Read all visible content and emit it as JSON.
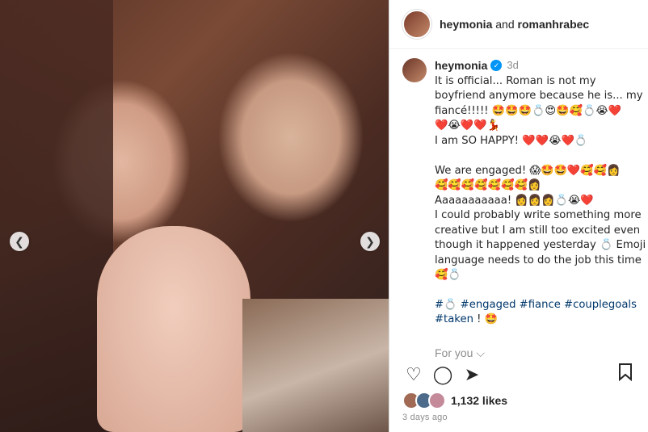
{
  "post": {
    "header": {
      "user1": "heymonia",
      "joiner": "and",
      "user2": "romanhrabec"
    },
    "caption": {
      "username": "heymonia",
      "verified_icon": "verified-badge-icon",
      "age": "3d",
      "lines": [
        "It is official... Roman is not my",
        "boyfriend anymore because he is... my",
        "fiancé!!!!! 🤩🤩🤩💍😍🤩🥰💍😭❤️",
        "❤️😭❤️❤️💃",
        "I am SO HAPPY! ❤️❤️😭❤️💍",
        "",
        "We are engaged! 😱🤩🤩❤️🥰🥰👩",
        "🥰🥰🥰🥰🥰🥰🥰👩",
        "Aaaaaaaaaaa! 👩👩👩💍😭❤️",
        "I could probably write something more",
        "creative but I am still too excited even",
        "though it happened yesterday 💍 Emoji",
        "language needs to do the job this time",
        "🥰💍"
      ],
      "hashtags_line1": "#💍 #engaged #fiance #couplegoals",
      "hashtags_line2": "#taken",
      "hashtags_suffix": "! 🤩",
      "for_you": "For you ⌵"
    },
    "likes": "1,132 likes",
    "posted_ago": "3 days ago"
  },
  "icons": {
    "prev": "chevron-left-icon",
    "next": "chevron-right-icon",
    "like": "heart-icon",
    "comment": "comment-icon",
    "share": "send-icon",
    "save": "bookmark-icon"
  }
}
